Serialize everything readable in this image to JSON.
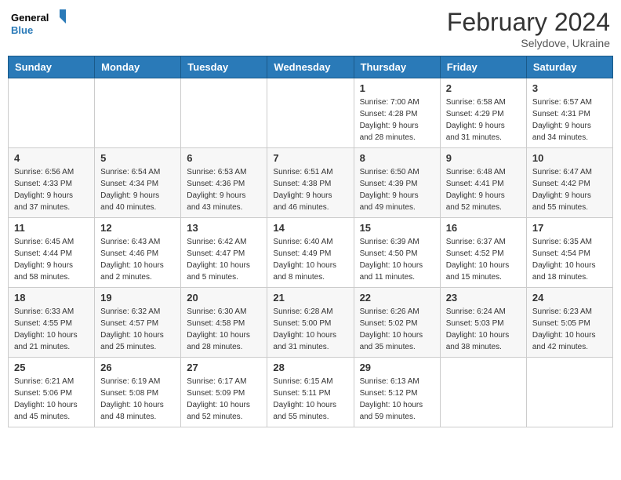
{
  "header": {
    "logo_general": "General",
    "logo_blue": "Blue",
    "month_year": "February 2024",
    "location": "Selydove, Ukraine"
  },
  "weekdays": [
    "Sunday",
    "Monday",
    "Tuesday",
    "Wednesday",
    "Thursday",
    "Friday",
    "Saturday"
  ],
  "weeks": [
    [
      {
        "day": "",
        "info": ""
      },
      {
        "day": "",
        "info": ""
      },
      {
        "day": "",
        "info": ""
      },
      {
        "day": "",
        "info": ""
      },
      {
        "day": "1",
        "info": "Sunrise: 7:00 AM\nSunset: 4:28 PM\nDaylight: 9 hours\nand 28 minutes."
      },
      {
        "day": "2",
        "info": "Sunrise: 6:58 AM\nSunset: 4:29 PM\nDaylight: 9 hours\nand 31 minutes."
      },
      {
        "day": "3",
        "info": "Sunrise: 6:57 AM\nSunset: 4:31 PM\nDaylight: 9 hours\nand 34 minutes."
      }
    ],
    [
      {
        "day": "4",
        "info": "Sunrise: 6:56 AM\nSunset: 4:33 PM\nDaylight: 9 hours\nand 37 minutes."
      },
      {
        "day": "5",
        "info": "Sunrise: 6:54 AM\nSunset: 4:34 PM\nDaylight: 9 hours\nand 40 minutes."
      },
      {
        "day": "6",
        "info": "Sunrise: 6:53 AM\nSunset: 4:36 PM\nDaylight: 9 hours\nand 43 minutes."
      },
      {
        "day": "7",
        "info": "Sunrise: 6:51 AM\nSunset: 4:38 PM\nDaylight: 9 hours\nand 46 minutes."
      },
      {
        "day": "8",
        "info": "Sunrise: 6:50 AM\nSunset: 4:39 PM\nDaylight: 9 hours\nand 49 minutes."
      },
      {
        "day": "9",
        "info": "Sunrise: 6:48 AM\nSunset: 4:41 PM\nDaylight: 9 hours\nand 52 minutes."
      },
      {
        "day": "10",
        "info": "Sunrise: 6:47 AM\nSunset: 4:42 PM\nDaylight: 9 hours\nand 55 minutes."
      }
    ],
    [
      {
        "day": "11",
        "info": "Sunrise: 6:45 AM\nSunset: 4:44 PM\nDaylight: 9 hours\nand 58 minutes."
      },
      {
        "day": "12",
        "info": "Sunrise: 6:43 AM\nSunset: 4:46 PM\nDaylight: 10 hours\nand 2 minutes."
      },
      {
        "day": "13",
        "info": "Sunrise: 6:42 AM\nSunset: 4:47 PM\nDaylight: 10 hours\nand 5 minutes."
      },
      {
        "day": "14",
        "info": "Sunrise: 6:40 AM\nSunset: 4:49 PM\nDaylight: 10 hours\nand 8 minutes."
      },
      {
        "day": "15",
        "info": "Sunrise: 6:39 AM\nSunset: 4:50 PM\nDaylight: 10 hours\nand 11 minutes."
      },
      {
        "day": "16",
        "info": "Sunrise: 6:37 AM\nSunset: 4:52 PM\nDaylight: 10 hours\nand 15 minutes."
      },
      {
        "day": "17",
        "info": "Sunrise: 6:35 AM\nSunset: 4:54 PM\nDaylight: 10 hours\nand 18 minutes."
      }
    ],
    [
      {
        "day": "18",
        "info": "Sunrise: 6:33 AM\nSunset: 4:55 PM\nDaylight: 10 hours\nand 21 minutes."
      },
      {
        "day": "19",
        "info": "Sunrise: 6:32 AM\nSunset: 4:57 PM\nDaylight: 10 hours\nand 25 minutes."
      },
      {
        "day": "20",
        "info": "Sunrise: 6:30 AM\nSunset: 4:58 PM\nDaylight: 10 hours\nand 28 minutes."
      },
      {
        "day": "21",
        "info": "Sunrise: 6:28 AM\nSunset: 5:00 PM\nDaylight: 10 hours\nand 31 minutes."
      },
      {
        "day": "22",
        "info": "Sunrise: 6:26 AM\nSunset: 5:02 PM\nDaylight: 10 hours\nand 35 minutes."
      },
      {
        "day": "23",
        "info": "Sunrise: 6:24 AM\nSunset: 5:03 PM\nDaylight: 10 hours\nand 38 minutes."
      },
      {
        "day": "24",
        "info": "Sunrise: 6:23 AM\nSunset: 5:05 PM\nDaylight: 10 hours\nand 42 minutes."
      }
    ],
    [
      {
        "day": "25",
        "info": "Sunrise: 6:21 AM\nSunset: 5:06 PM\nDaylight: 10 hours\nand 45 minutes."
      },
      {
        "day": "26",
        "info": "Sunrise: 6:19 AM\nSunset: 5:08 PM\nDaylight: 10 hours\nand 48 minutes."
      },
      {
        "day": "27",
        "info": "Sunrise: 6:17 AM\nSunset: 5:09 PM\nDaylight: 10 hours\nand 52 minutes."
      },
      {
        "day": "28",
        "info": "Sunrise: 6:15 AM\nSunset: 5:11 PM\nDaylight: 10 hours\nand 55 minutes."
      },
      {
        "day": "29",
        "info": "Sunrise: 6:13 AM\nSunset: 5:12 PM\nDaylight: 10 hours\nand 59 minutes."
      },
      {
        "day": "",
        "info": ""
      },
      {
        "day": "",
        "info": ""
      }
    ]
  ],
  "colors": {
    "header_bg": "#2a7ab8",
    "logo_blue": "#2a7ab8"
  }
}
